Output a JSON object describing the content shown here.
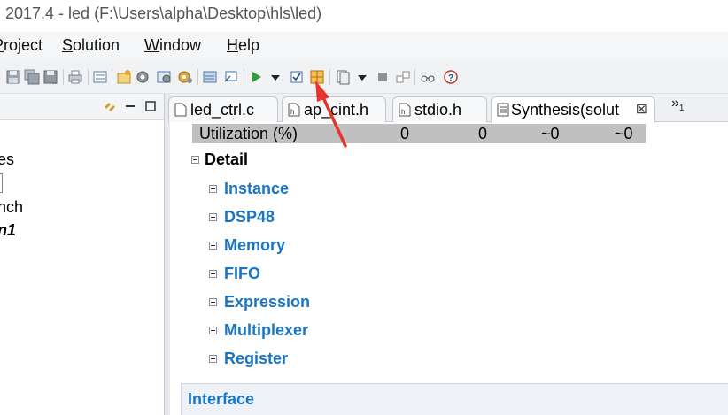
{
  "window": {
    "title": "2017.4 - led (F:\\Users\\alpha\\Desktop\\hls\\led)"
  },
  "menu": {
    "project": {
      "underlined": "P",
      "rest": "roject"
    },
    "solution": {
      "underlined": "S",
      "rest": "olution"
    },
    "window": {
      "underlined": "W",
      "rest": "indow"
    },
    "help": {
      "underlined": "H",
      "rest": "elp"
    }
  },
  "toolbar": {
    "icons": [
      "save-icon",
      "save-all-icon",
      "save-as-icon",
      "print-icon",
      "new-project-icon",
      "new-solution-icon",
      "project-settings-icon",
      "solution-settings-icon",
      "index-icon",
      "console-icon",
      "run-c-simulation-icon",
      "run-dropdown-icon",
      "run-synthesis-icon",
      "analysis-perspective-icon",
      "compare-reports-icon",
      "compare-dropdown-icon",
      "stop-icon",
      "export-rtl-icon",
      "waveform-icon",
      "debug-icon"
    ],
    "accent_colors": {
      "run": "#2e9e3a",
      "highlight": "#f0a020"
    }
  },
  "explorer": {
    "partial_items": [
      "es",
      "nch",
      "n1"
    ]
  },
  "tabs": [
    {
      "label": "led_ctrl.c",
      "icon": "c-source-icon"
    },
    {
      "label": "ap_cint.h",
      "icon": "header-file-icon"
    },
    {
      "label": "stdio.h",
      "icon": "header-file-icon"
    },
    {
      "label": "Synthesis(solut",
      "icon": "report-icon",
      "close": "⊠"
    }
  ],
  "tabs_overflow": {
    "chevron": "»",
    "count": "1"
  },
  "report": {
    "utilization": {
      "label": "Utilization (%)",
      "values": [
        "0",
        "0",
        "~0",
        "~0"
      ]
    },
    "detail_label": "Detail",
    "sections": [
      "Instance",
      "DSP48",
      "Memory",
      "FIFO",
      "Expression",
      "Multiplexer",
      "Register"
    ],
    "interface_label": "Interface"
  },
  "colors": {
    "link": "#1976c5",
    "annotation_arrow": "#e8352c",
    "util_row": "#c0c0c0"
  }
}
